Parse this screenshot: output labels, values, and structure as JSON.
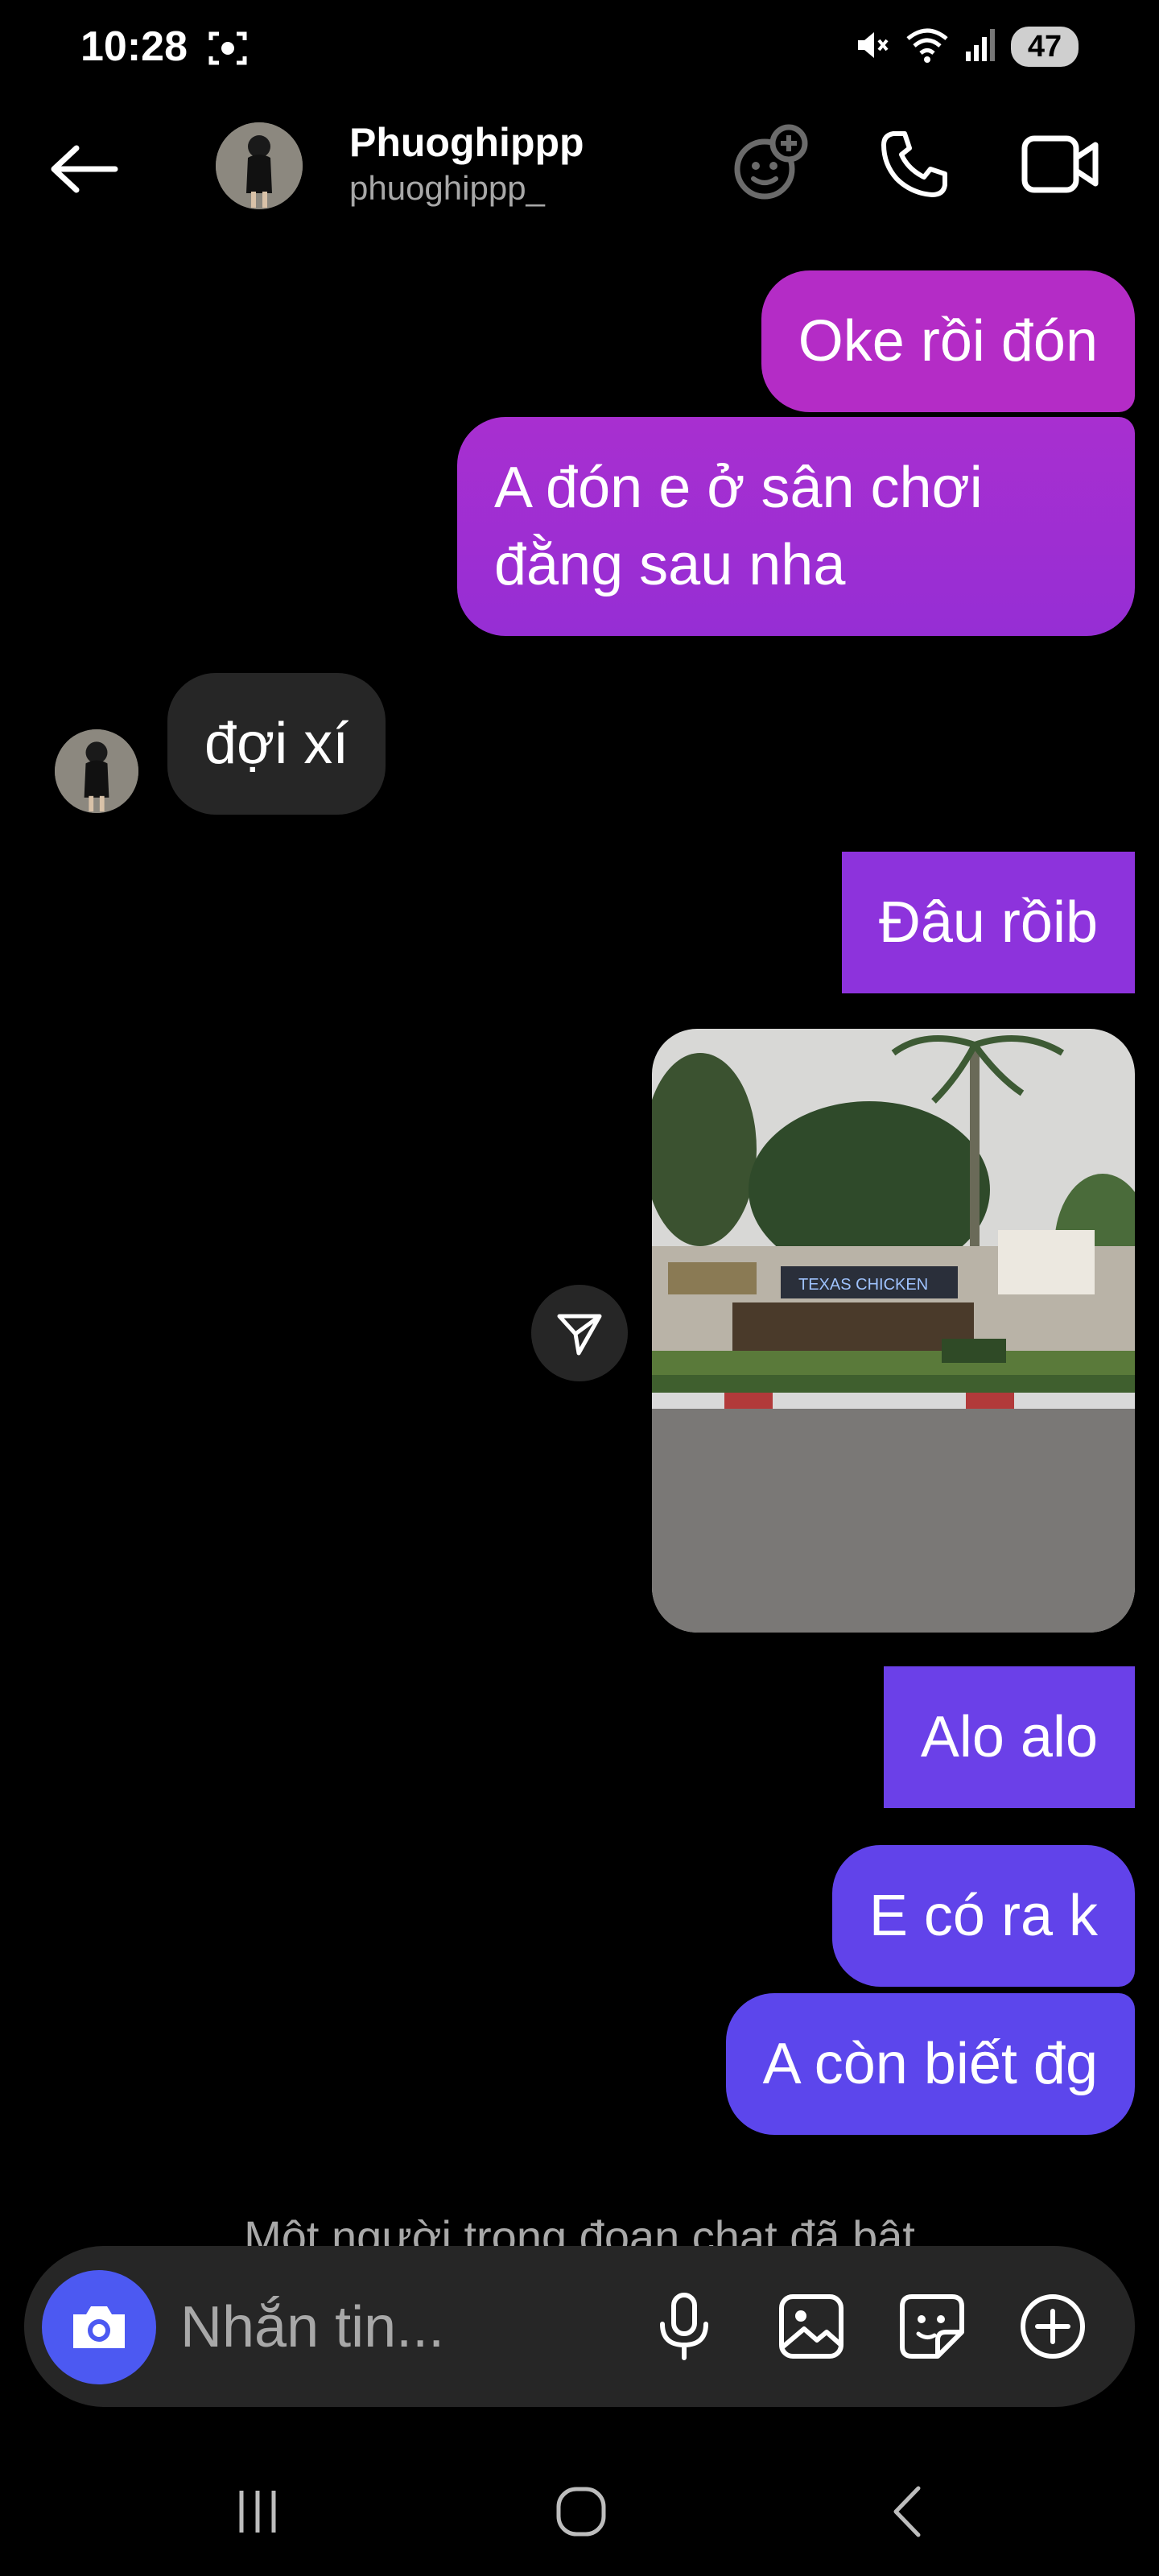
{
  "status_bar": {
    "time": "10:28",
    "battery": "47",
    "icons": [
      "screen-record-icon",
      "mute-icon",
      "wifi-icon",
      "signal-icon",
      "battery-icon"
    ]
  },
  "header": {
    "name": "Phuoghippp",
    "handle": "phuoghippp_",
    "icons": [
      "back-arrow-icon",
      "effects-icon",
      "phone-icon",
      "video-call-icon"
    ]
  },
  "messages": [
    {
      "sender": "me",
      "text": "Oke rồi đón"
    },
    {
      "sender": "me",
      "text": "A đón e ở sân chơi đằng sau nha"
    },
    {
      "sender": "them",
      "text": "đợi xí"
    },
    {
      "sender": "me",
      "text": "Đâu rồib"
    },
    {
      "sender": "me",
      "type": "photo",
      "sign_text": "TEXAS CHICKEN"
    },
    {
      "sender": "me",
      "text": "Alo alo"
    },
    {
      "sender": "me",
      "text": "E có ra k"
    },
    {
      "sender": "me",
      "text": "A còn biết đg"
    }
  ],
  "notice": "Một người trong đoạn chat đã bật",
  "composer": {
    "placeholder": "Nhắn tin...",
    "icons": [
      "camera-icon",
      "microphone-icon",
      "gallery-icon",
      "sticker-icon",
      "plus-icon"
    ]
  },
  "colors": {
    "background": "#000000",
    "incoming_bubble": "#262626",
    "outgoing_top": "#b42cc6",
    "outgoing_bottom": "#5c46ec",
    "camera_button": "#4c59f2"
  },
  "nav": {
    "icons": [
      "recent-apps-icon",
      "home-icon",
      "back-icon"
    ]
  }
}
